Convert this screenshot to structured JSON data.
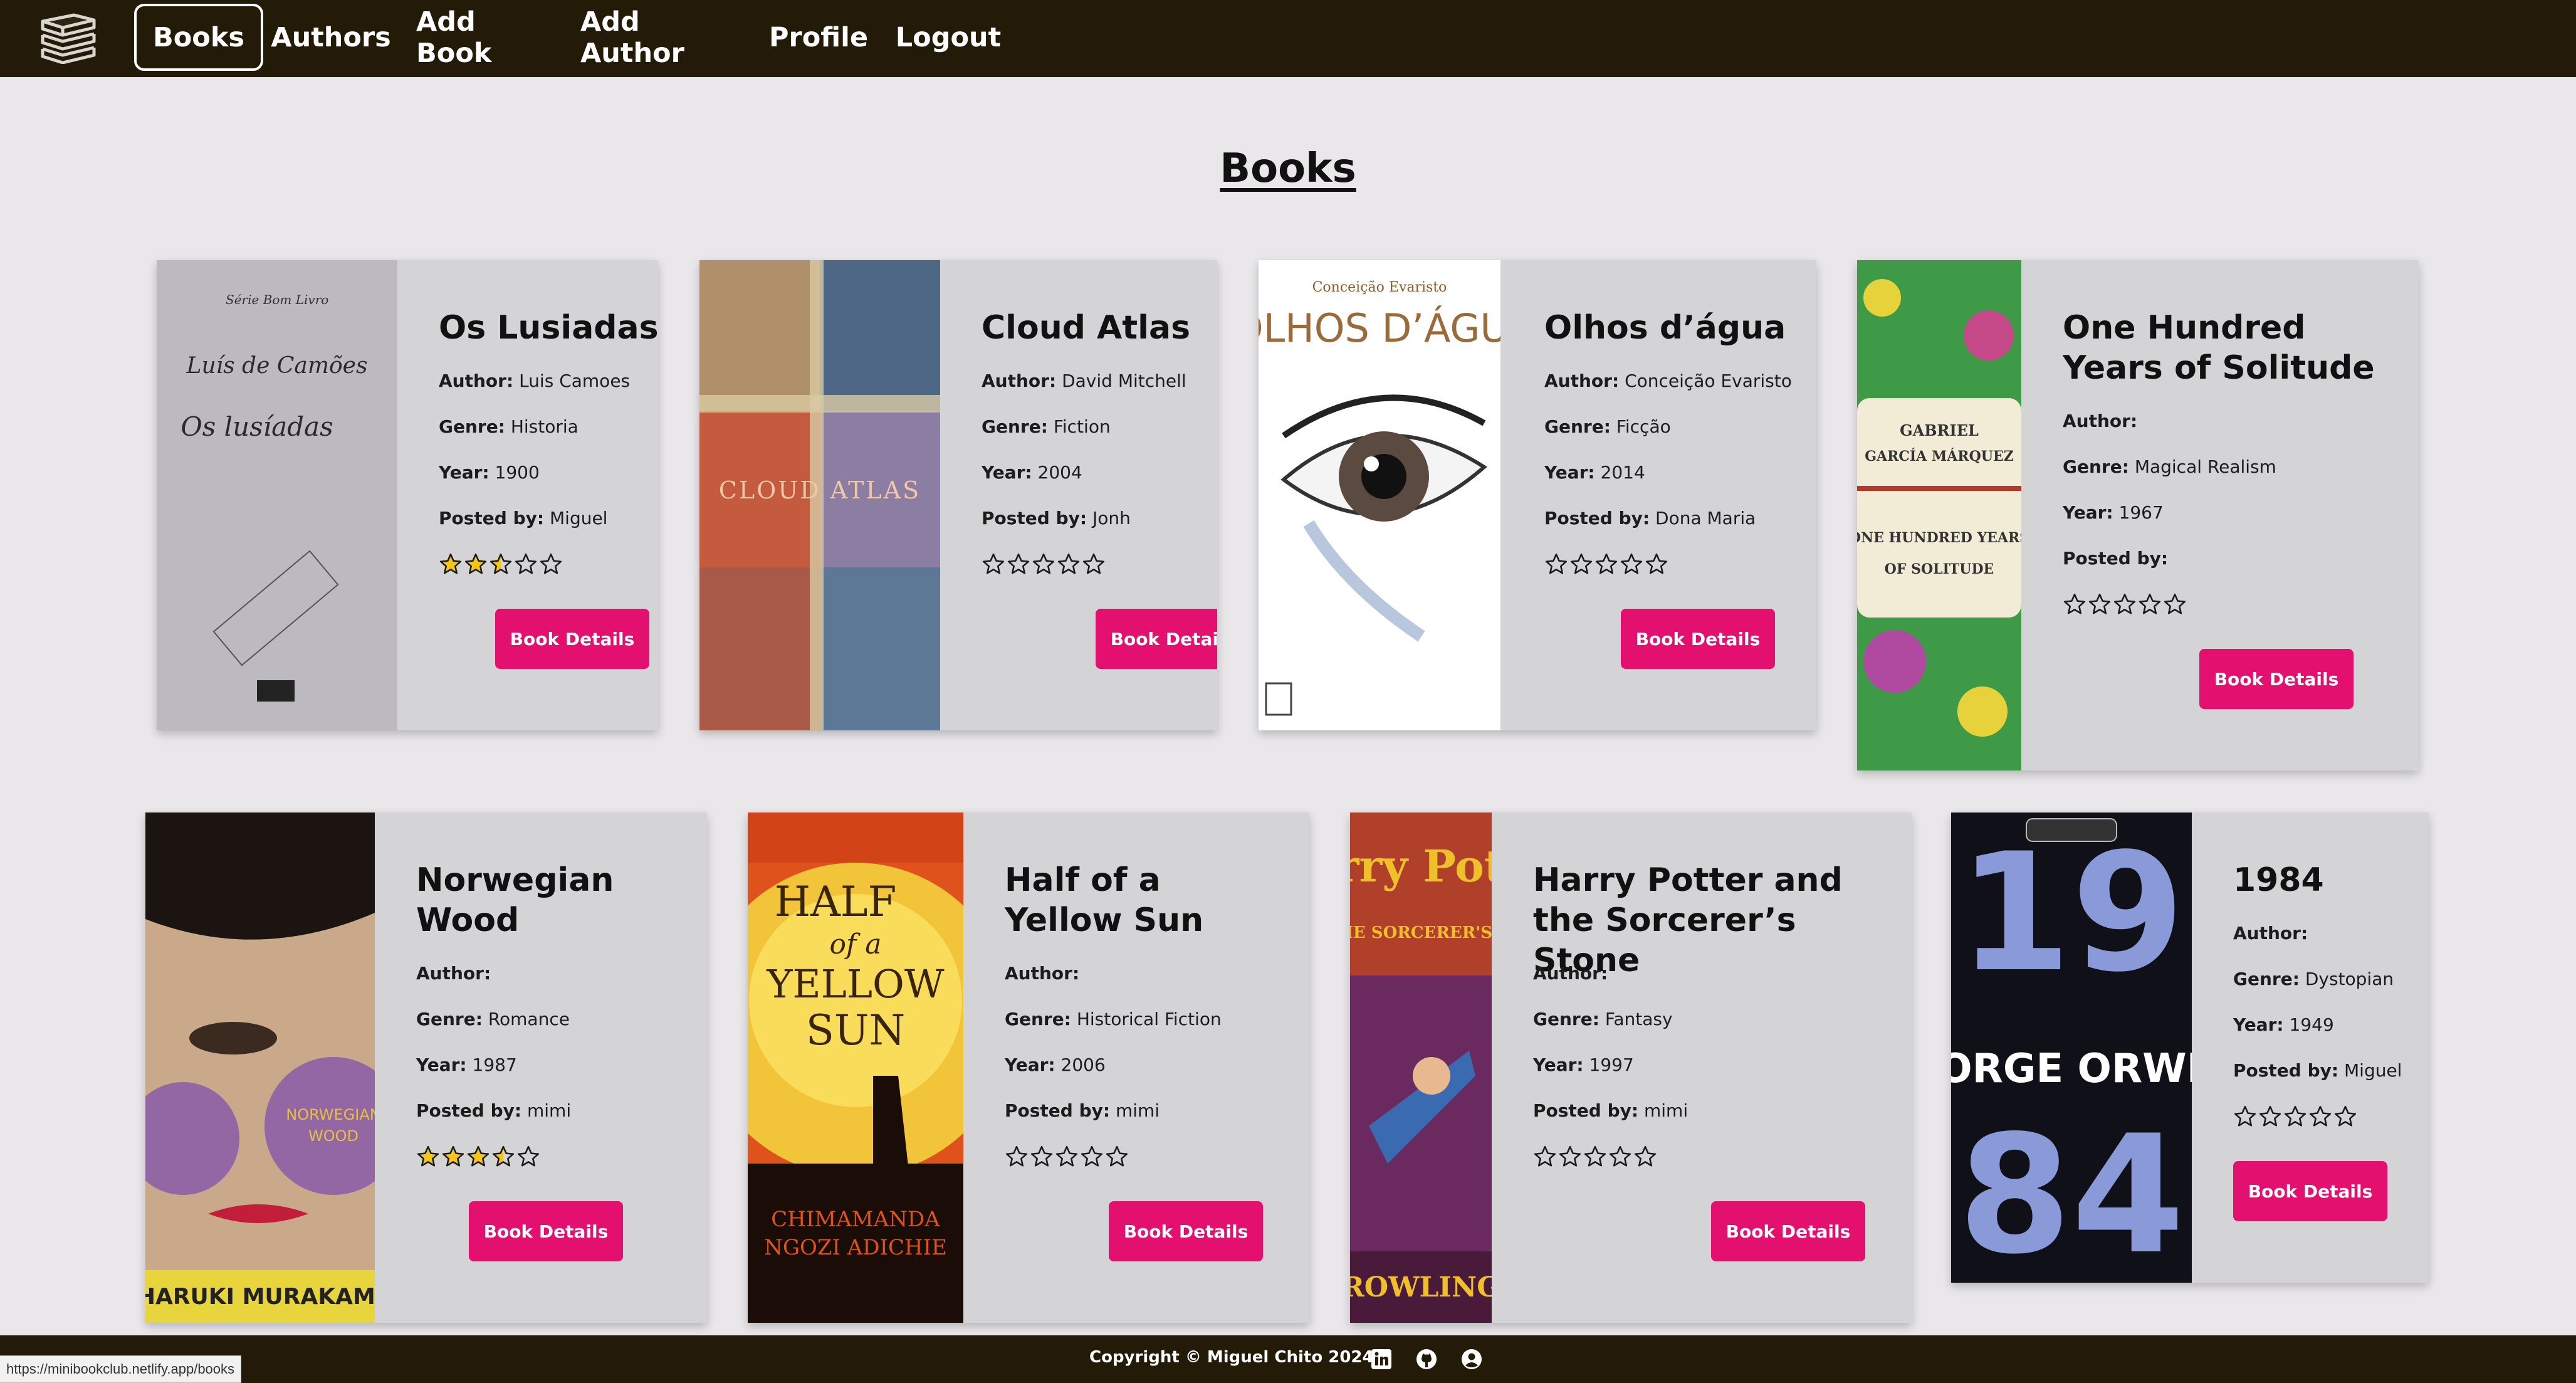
{
  "nav": {
    "items": [
      {
        "label": "Books"
      },
      {
        "label": "Authors"
      },
      {
        "label": "Add Book"
      },
      {
        "label": "Add Author"
      },
      {
        "label": "Profile"
      },
      {
        "label": "Logout"
      }
    ]
  },
  "page": {
    "title": "Books"
  },
  "labels": {
    "author": "Author:",
    "genre": "Genre:",
    "year": "Year:",
    "posted_by": "Posted by:",
    "details_button": "Book Details"
  },
  "books": [
    {
      "title": "Os Lusiadas",
      "author": "Luis Camoes",
      "genre": "Historia",
      "year": "1900",
      "posted_by": "Miguel",
      "rating": 2.5,
      "cover_text": [
        "Luís de Camões",
        "Os lusíadas"
      ]
    },
    {
      "title": "Cloud Atlas",
      "author": "David Mitchell",
      "genre": "Fiction",
      "year": "2004",
      "posted_by": "Jonh",
      "rating": 0,
      "cover_text": [
        "CLOUD ATLAS"
      ]
    },
    {
      "title": "Olhos d’água",
      "author": "Conceição Evaristo",
      "genre": "Ficção",
      "year": "2014",
      "posted_by": "Dona Maria",
      "rating": 0,
      "cover_text": [
        "Conceição Evaristo",
        "OLHOS D’ÁGUA"
      ]
    },
    {
      "title": "One Hundred Years of Solitude",
      "author": "",
      "genre": "Magical Realism",
      "year": "1967",
      "posted_by": "",
      "rating": 0,
      "cover_text": [
        "GABRIEL",
        "GARCÍA MÁRQUEZ",
        "ONE HUNDRED YEARS",
        "OF SOLITUDE"
      ]
    },
    {
      "title": "Norwegian Wood",
      "author": "",
      "genre": "Romance",
      "year": "1987",
      "posted_by": "mimi",
      "rating": 3.5,
      "cover_text": [
        "NORWEGIAN",
        "WOOD",
        "HARUKI MURAKAMI"
      ]
    },
    {
      "title": "Half of a Yellow Sun",
      "author": "",
      "genre": "Historical Fiction",
      "year": "2006",
      "posted_by": "mimi",
      "rating": 0,
      "cover_text": [
        "HALF",
        "of a",
        "YELLOW",
        "SUN",
        "CHIMAMANDA",
        "NGOZI ADICHIE"
      ]
    },
    {
      "title": "Harry Potter and the Sorcerer’s Stone",
      "author": "",
      "genre": "Fantasy",
      "year": "1997",
      "posted_by": "mimi",
      "rating": 0,
      "cover_text": [
        "Harry Potter",
        "AND THE SORCERER'S STONE",
        "ROWLING"
      ]
    },
    {
      "title": "1984",
      "author": "",
      "genre": "Dystopian",
      "year": "1949",
      "posted_by": "Miguel",
      "rating": 0,
      "cover_text": [
        "19",
        "GEORGE ORWELL",
        "84"
      ]
    }
  ],
  "footer": {
    "copyright": "Copyright © Miguel Chito 2024",
    "icons": [
      "linkedin-icon",
      "github-icon",
      "user-circle-icon"
    ]
  },
  "status_bar": {
    "url": "https://minibookclub.netlify.app/books"
  },
  "colors": {
    "nav_bg": "#231a07",
    "page_bg": "#e9e7e9",
    "card_bg": "#d4d3d5",
    "button": "#e4106f",
    "star_fill": "#f5c518"
  }
}
